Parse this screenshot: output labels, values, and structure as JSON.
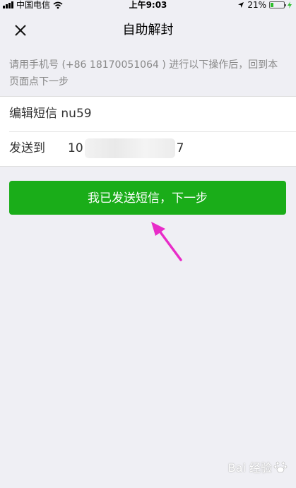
{
  "status_bar": {
    "carrier": "中国电信",
    "time": "上午9:03",
    "battery_percent": "21%",
    "battery_level": 0.21
  },
  "nav": {
    "title": "自助解封",
    "close_icon": "close-icon"
  },
  "hint": {
    "text": "请用手机号 (+86 18170051064 ) 进行以下操作后，回到本页面点下一步"
  },
  "sms": {
    "edit_text": "编辑短信 nu59",
    "send_label": "发送到",
    "send_prefix": "10",
    "send_suffix": "7"
  },
  "primary_button": {
    "label": "我已发送短信，下一步"
  },
  "colors": {
    "primary": "#1aad19",
    "background": "#efeff4",
    "annotation_arrow": "#e82cc8"
  },
  "watermark": {
    "text": "Bai 经验"
  }
}
